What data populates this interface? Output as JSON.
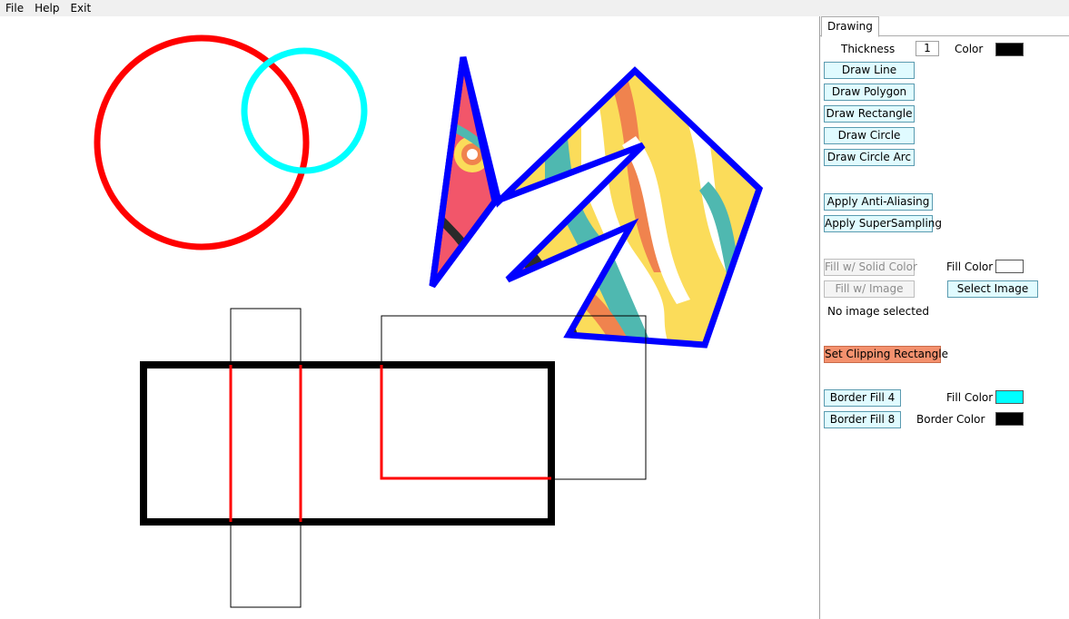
{
  "menu": [
    "File",
    "Help",
    "Exit"
  ],
  "panel": {
    "tab_label": "Drawing",
    "thickness_label": "Thickness",
    "thickness_value": "1",
    "color_label": "Color",
    "color_value": "#000000",
    "draw_line": "Draw Line",
    "draw_polygon": "Draw Polygon",
    "draw_rectangle": "Draw Rectangle",
    "draw_circle": "Draw Circle",
    "draw_circle_arc": "Draw Circle Arc",
    "anti_aliasing": "Apply Anti-Aliasing",
    "supersampling": "Apply SuperSampling",
    "fill_solid": "Fill w/ Solid Color",
    "fill_color_label": "Fill Color",
    "fill_color_value": "#ffffff",
    "fill_image": "Fill w/ Image",
    "select_image": "Select Image",
    "image_status": "No image selected",
    "clipping_rect": "Set Clipping Rectangle",
    "border_fill_4": "Border Fill 4",
    "border_fill_8": "Border Fill 8",
    "border_fill_color_label": "Fill Color",
    "border_fill_color_value": "#00ffff",
    "border_color_label": "Border Color",
    "border_color_value": "#000000"
  },
  "shapes_colors": {
    "circle_1": "#ff0000",
    "circle_2": "#00ffff",
    "polygon_outline": "#0000ff",
    "rectangle": "#000000",
    "clipped_lines": "#ff0000"
  }
}
